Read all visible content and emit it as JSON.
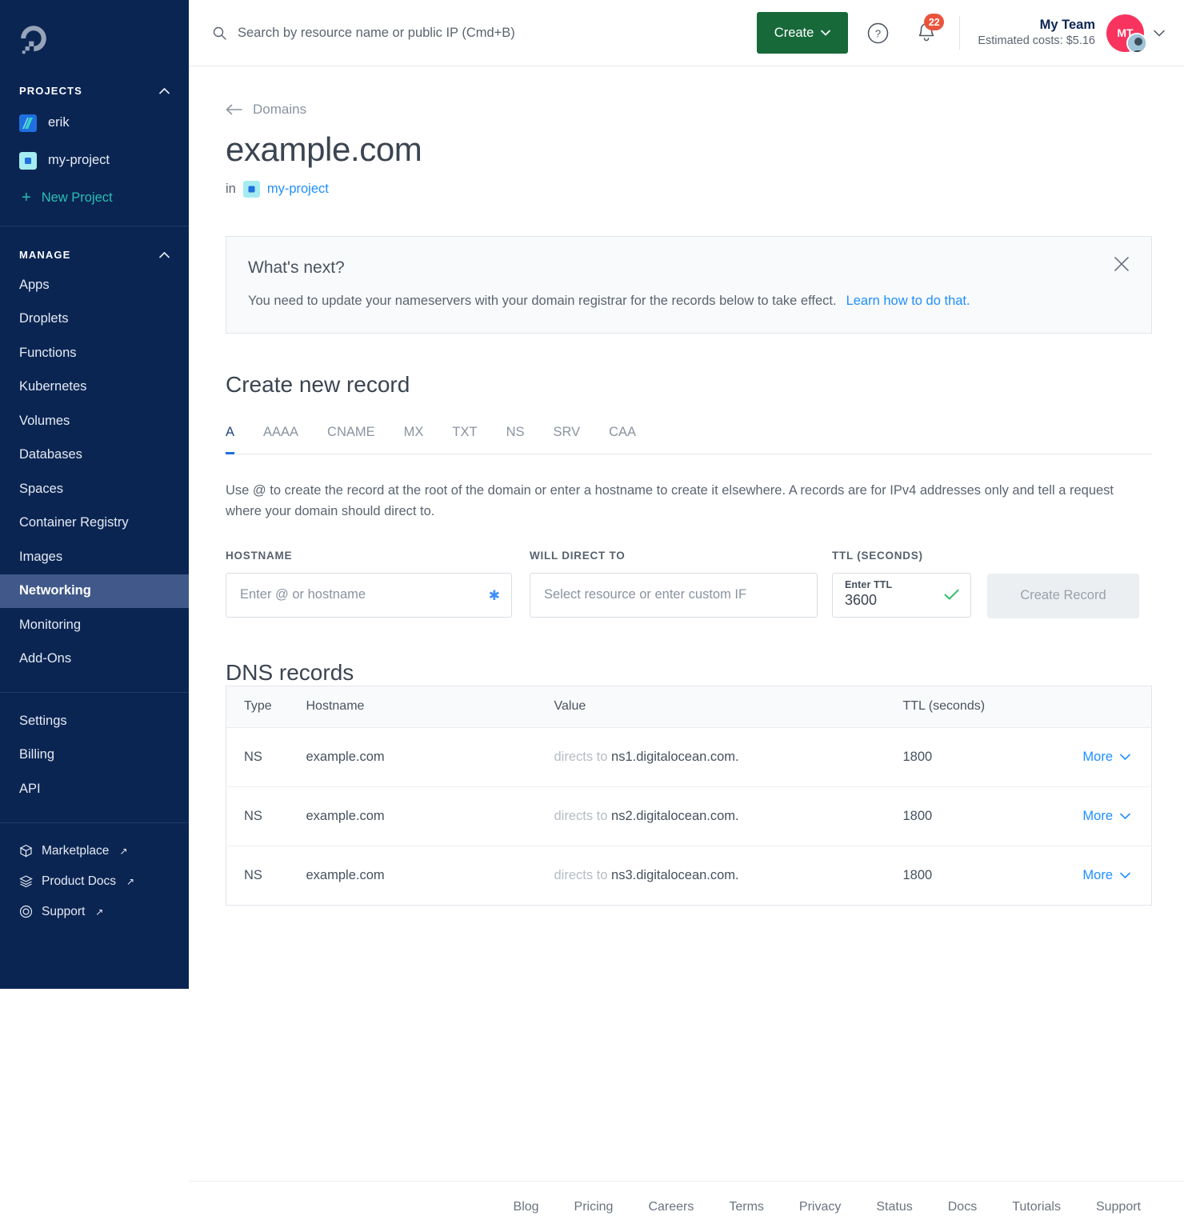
{
  "sidebar": {
    "logo": "digitalocean-logo",
    "projects_header": "PROJECTS",
    "projects": [
      {
        "label": "erik",
        "icon": "project-stripes-icon"
      },
      {
        "label": "my-project",
        "icon": "project-square-icon"
      }
    ],
    "new_project": "New Project",
    "manage_header": "MANAGE",
    "manage_items": [
      "Apps",
      "Droplets",
      "Functions",
      "Kubernetes",
      "Volumes",
      "Databases",
      "Spaces",
      "Container Registry",
      "Images",
      "Networking",
      "Monitoring",
      "Add-Ons"
    ],
    "active_item": "Networking",
    "account_items": [
      "Settings",
      "Billing",
      "API"
    ],
    "external_items": [
      {
        "label": "Marketplace",
        "icon": "cube-icon"
      },
      {
        "label": "Product Docs",
        "icon": "layers-icon"
      },
      {
        "label": "Support",
        "icon": "lifering-icon"
      }
    ],
    "external_arrow": "↗"
  },
  "topbar": {
    "search_placeholder": "Search by resource name or public IP (Cmd+B)",
    "search_value": "",
    "create_label": "Create",
    "help_icon": "question-circle-icon",
    "bell_icon": "bell-icon",
    "notification_count": "22",
    "team_name": "My Team",
    "estimated_costs": "Estimated costs: $5.16",
    "avatar_initials": "MT"
  },
  "page": {
    "breadcrumb": "Domains",
    "title": "example.com",
    "in_label": "in",
    "project_link": "my-project"
  },
  "notice": {
    "title": "What's next?",
    "text": "You need to update your nameservers with your domain registrar for the records below to take effect.",
    "link": "Learn how to do that.",
    "close_icon": "close-icon"
  },
  "create_record": {
    "heading": "Create new record",
    "tabs": [
      "A",
      "AAAA",
      "CNAME",
      "MX",
      "TXT",
      "NS",
      "SRV",
      "CAA"
    ],
    "active_tab": "A",
    "description": "Use @ to create the record at the root of the domain or enter a hostname to create it elsewhere. A records are for IPv4 addresses only and tell a request where your domain should direct to.",
    "hostname_label": "HOSTNAME",
    "hostname_placeholder": "Enter @ or hostname",
    "hostname_value": "",
    "required_marker": "✱",
    "direct_label": "WILL DIRECT TO",
    "direct_placeholder": "Select resource or enter custom IF",
    "direct_value": "",
    "ttl_label": "TTL (SECONDS)",
    "ttl_inner_label": "Enter TTL",
    "ttl_value": "3600",
    "ttl_valid_icon": "check-icon",
    "submit_label": "Create Record"
  },
  "dns_records": {
    "heading": "DNS records",
    "columns": [
      "Type",
      "Hostname",
      "Value",
      "TTL (seconds)",
      ""
    ],
    "rows": [
      {
        "type": "NS",
        "hostname": "example.com",
        "directs_prefix": "directs to",
        "value": "ns1.digitalocean.com.",
        "ttl": "1800",
        "more": "More"
      },
      {
        "type": "NS",
        "hostname": "example.com",
        "directs_prefix": "directs to",
        "value": "ns2.digitalocean.com.",
        "ttl": "1800",
        "more": "More"
      },
      {
        "type": "NS",
        "hostname": "example.com",
        "directs_prefix": "directs to",
        "value": "ns3.digitalocean.com.",
        "ttl": "1800",
        "more": "More"
      }
    ]
  },
  "footer": {
    "links": [
      "Blog",
      "Pricing",
      "Careers",
      "Terms",
      "Privacy",
      "Status",
      "Docs",
      "Tutorials",
      "Support"
    ]
  },
  "colors": {
    "sidebar_bg": "#0b2553",
    "sidebar_active": "#41598a",
    "accent_teal": "#2bbfb3",
    "create_green": "#17693a",
    "link_blue": "#1f8fff",
    "badge_red": "#e8553c",
    "avatar_pink": "#f7335e",
    "tab_underline": "#1f6fe0"
  }
}
